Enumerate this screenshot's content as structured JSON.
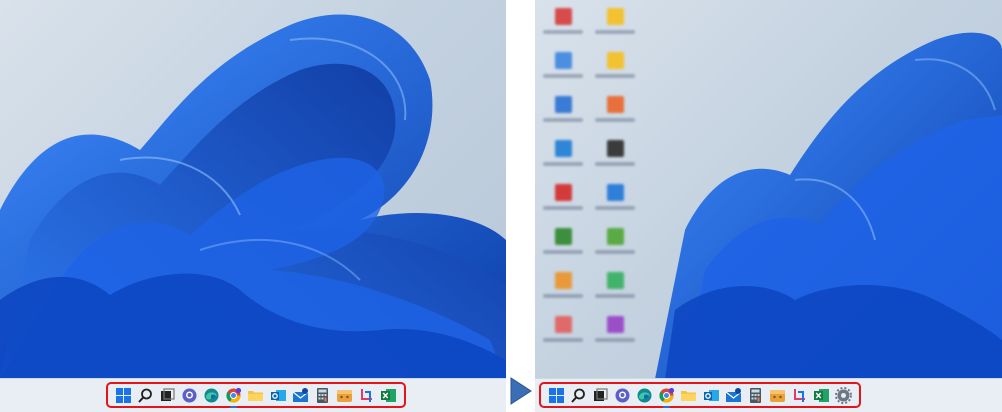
{
  "left_screen": {
    "taskbar_icons": [
      {
        "name": "start-icon"
      },
      {
        "name": "search-icon"
      },
      {
        "name": "task-view-icon"
      },
      {
        "name": "chat-icon"
      },
      {
        "name": "edge-icon"
      },
      {
        "name": "chrome-icon"
      },
      {
        "name": "file-explorer-icon"
      },
      {
        "name": "outlook-icon"
      },
      {
        "name": "mail-icon"
      },
      {
        "name": "calculator-icon"
      },
      {
        "name": "archive-icon"
      },
      {
        "name": "snipping-tool-icon"
      },
      {
        "name": "excel-icon"
      }
    ]
  },
  "right_screen": {
    "taskbar_icons": [
      {
        "name": "start-icon"
      },
      {
        "name": "search-icon"
      },
      {
        "name": "task-view-icon"
      },
      {
        "name": "chat-icon"
      },
      {
        "name": "edge-icon"
      },
      {
        "name": "chrome-icon"
      },
      {
        "name": "file-explorer-icon"
      },
      {
        "name": "outlook-icon"
      },
      {
        "name": "mail-icon"
      },
      {
        "name": "calculator-icon"
      },
      {
        "name": "archive-icon"
      },
      {
        "name": "snipping-tool-icon"
      },
      {
        "name": "excel-icon"
      },
      {
        "name": "settings-icon"
      }
    ],
    "desktop_icons": [
      {
        "name": "desktop-icon-1",
        "color": "#d64b4b"
      },
      {
        "name": "desktop-icon-2",
        "color": "#f2c230"
      },
      {
        "name": "desktop-icon-3",
        "color": "#4a8fe0"
      },
      {
        "name": "desktop-icon-4",
        "color": "#f2c230"
      },
      {
        "name": "desktop-icon-5",
        "color": "#3a7bd5"
      },
      {
        "name": "desktop-icon-6",
        "color": "#e8703a"
      },
      {
        "name": "desktop-icon-7",
        "color": "#2f86d6"
      },
      {
        "name": "desktop-icon-8",
        "color": "#3b3b3b"
      },
      {
        "name": "desktop-icon-9",
        "color": "#d33b3b"
      },
      {
        "name": "desktop-icon-10",
        "color": "#2f7fd8"
      },
      {
        "name": "desktop-icon-11",
        "color": "#3c8f3c"
      },
      {
        "name": "desktop-icon-12",
        "color": "#5aaa46"
      },
      {
        "name": "desktop-icon-13",
        "color": "#e89a3a"
      },
      {
        "name": "desktop-icon-14",
        "color": "#42b36a"
      },
      {
        "name": "desktop-icon-15",
        "color": "#e06a6a"
      },
      {
        "name": "desktop-icon-16",
        "color": "#9a4fc9"
      }
    ]
  },
  "colors": {
    "highlight_border": "#e4141b",
    "arrow": "#3b6fb5",
    "wallpaper_bloom": "#1a5fe0"
  }
}
